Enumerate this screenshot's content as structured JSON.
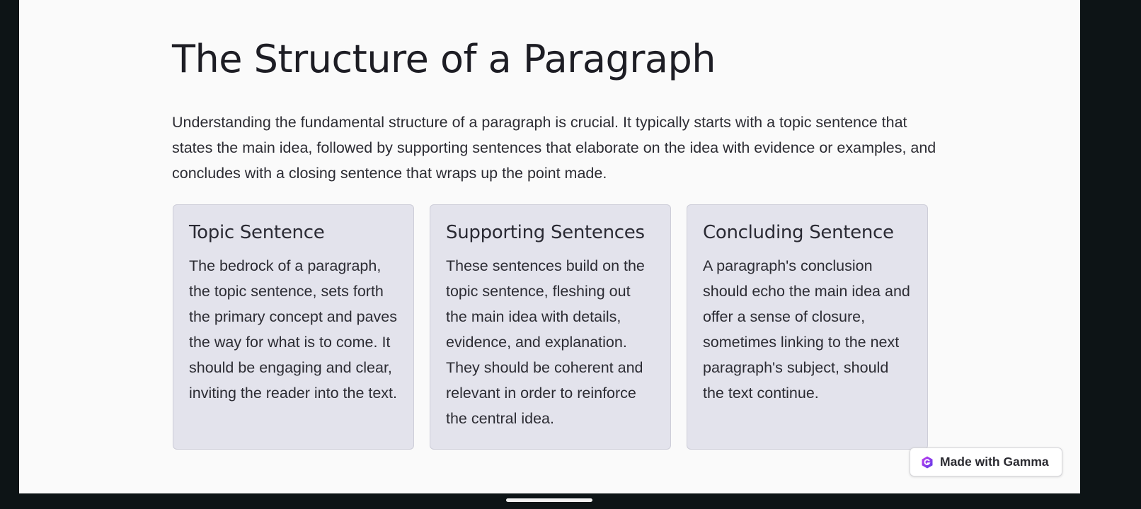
{
  "slide": {
    "title": "The Structure of a Paragraph",
    "intro": "Understanding the fundamental structure of a paragraph is crucial. It typically starts with a topic sentence that states the main idea, followed by supporting sentences that elaborate on the idea with evidence or examples, and concludes with a closing sentence that wraps up the point made.",
    "cards": [
      {
        "title": "Topic Sentence",
        "body": "The bedrock of a paragraph, the topic sentence, sets forth the primary concept and paves the way for what is to come. It should be engaging and clear, inviting the reader into the text."
      },
      {
        "title": "Supporting Sentences",
        "body": "These sentences build on the topic sentence, fleshing out the main idea with details, evidence, and explanation. They should be coherent and relevant in order to reinforce the central idea."
      },
      {
        "title": "Concluding Sentence",
        "body": "A paragraph's conclusion should echo the main idea and offer a sense of closure, sometimes linking to the next paragraph's subject, should the text continue."
      }
    ]
  },
  "badge": {
    "label": "Made with Gamma",
    "icon": "gamma-logo-icon"
  },
  "colors": {
    "background": "#0d1416",
    "slide": "#fafafa",
    "card": "#e3e3ec",
    "accent": "#7b3fe4"
  }
}
